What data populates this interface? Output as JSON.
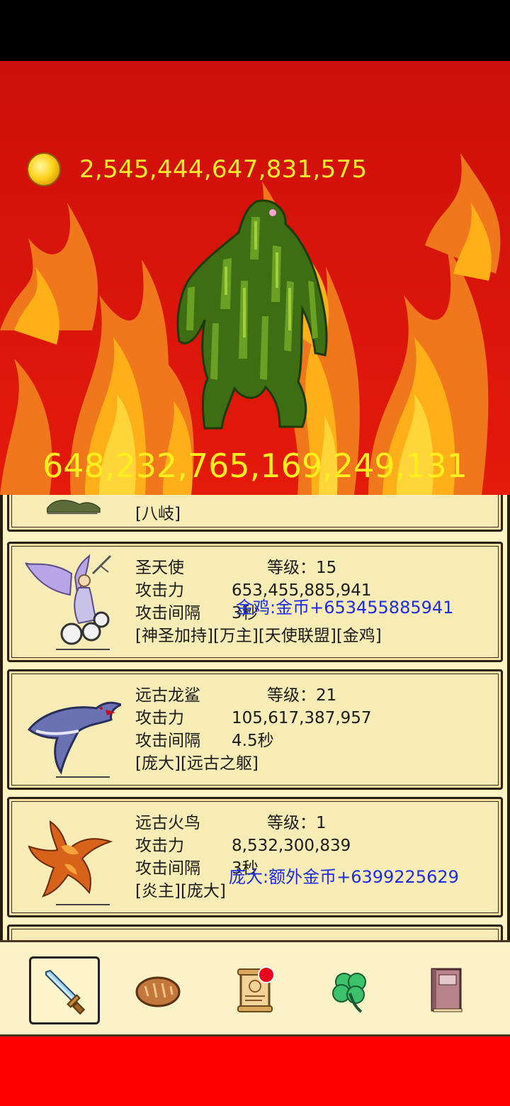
{
  "hud": {
    "gold_amount": "2,545,444,647,831,575",
    "boss_hp": "648,232,765,169,249,131"
  },
  "units": [
    {
      "name": "",
      "tags": "[八岐]"
    },
    {
      "name": "圣天使",
      "level_label": "等级：15",
      "attack_label": "攻击力",
      "attack_value": "653,455,885,941",
      "interval_label": "攻击间隔",
      "interval_value": "3秒",
      "tags": "[神圣加持][万主][天使联盟][金鸡]",
      "bonus": "金鸡:金币+653455885941"
    },
    {
      "name": "远古龙鲨",
      "level_label": "等级：21",
      "attack_label": "攻击力",
      "attack_value": "105,617,387,957",
      "interval_label": "攻击间隔",
      "interval_value": "4.5秒",
      "tags": "[庞大][远古之躯]"
    },
    {
      "name": "远古火鸟",
      "level_label": "等级：1",
      "attack_label": "攻击力",
      "attack_value": "8,532,300,839",
      "interval_label": "攻击间隔",
      "interval_value": "3秒",
      "tags": "[炎主][庞大]",
      "bonus": "庞大:额外金币+6399225629"
    }
  ],
  "tabs": [
    {
      "icon": "sword-icon",
      "active": true
    },
    {
      "icon": "bread-icon",
      "active": false
    },
    {
      "icon": "scroll-icon",
      "active": false,
      "has_notification": true
    },
    {
      "icon": "clover-icon",
      "active": false
    },
    {
      "icon": "book-icon",
      "active": false
    }
  ],
  "colors": {
    "gold_text": "#ffee2a",
    "bonus_text": "#1d2be6",
    "card_bg": "#f8ecb6",
    "scene_red": "#d8150b"
  }
}
